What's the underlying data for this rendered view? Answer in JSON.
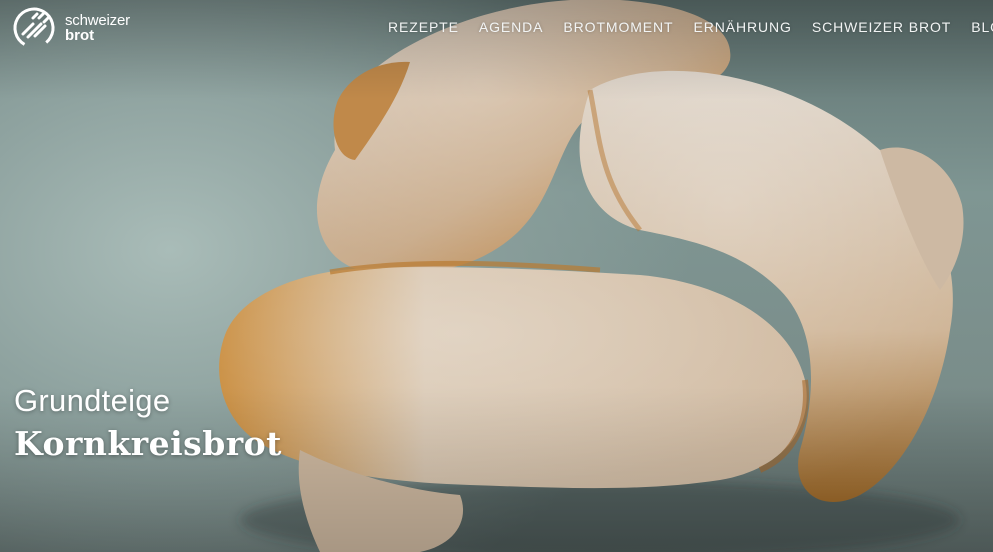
{
  "logo": {
    "line1": "schweizer",
    "line2": "brot"
  },
  "nav": {
    "items": [
      {
        "label": "REZEPTE"
      },
      {
        "label": "AGENDA"
      },
      {
        "label": "BROTMOMENT"
      },
      {
        "label": "ERNÄHRUNG"
      },
      {
        "label": "SCHWEIZER BROT"
      },
      {
        "label": "BLOG"
      }
    ]
  },
  "hero": {
    "category": "Grundteige",
    "title": "Kornkreisbrot"
  },
  "colors": {
    "background": "#7d8f8c",
    "crust": "#c98a3a",
    "flour": "#d9d2c8",
    "text": "#ffffff"
  }
}
